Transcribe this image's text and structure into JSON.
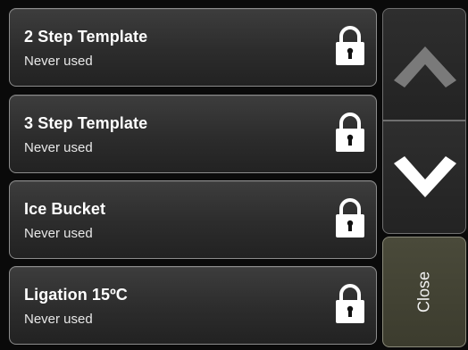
{
  "templates": [
    {
      "name": "2 Step Template",
      "status": "Never used",
      "icon": "lock-icon"
    },
    {
      "name": "3 Step Template",
      "status": "Never used",
      "icon": "lock-icon"
    },
    {
      "name": "Ice Bucket",
      "status": "Never used",
      "icon": "lock-icon"
    },
    {
      "name": "Ligation 15ºC",
      "status": "Never used",
      "icon": "lock-icon"
    }
  ],
  "nav": {
    "up_icon": "chevron-up-icon",
    "down_icon": "chevron-down-icon",
    "close_label": "Close"
  },
  "colors": {
    "background": "#0a0a0a",
    "item_background": "#2c2c2c",
    "close_background": "#3c3c2e",
    "text": "#ffffff"
  }
}
